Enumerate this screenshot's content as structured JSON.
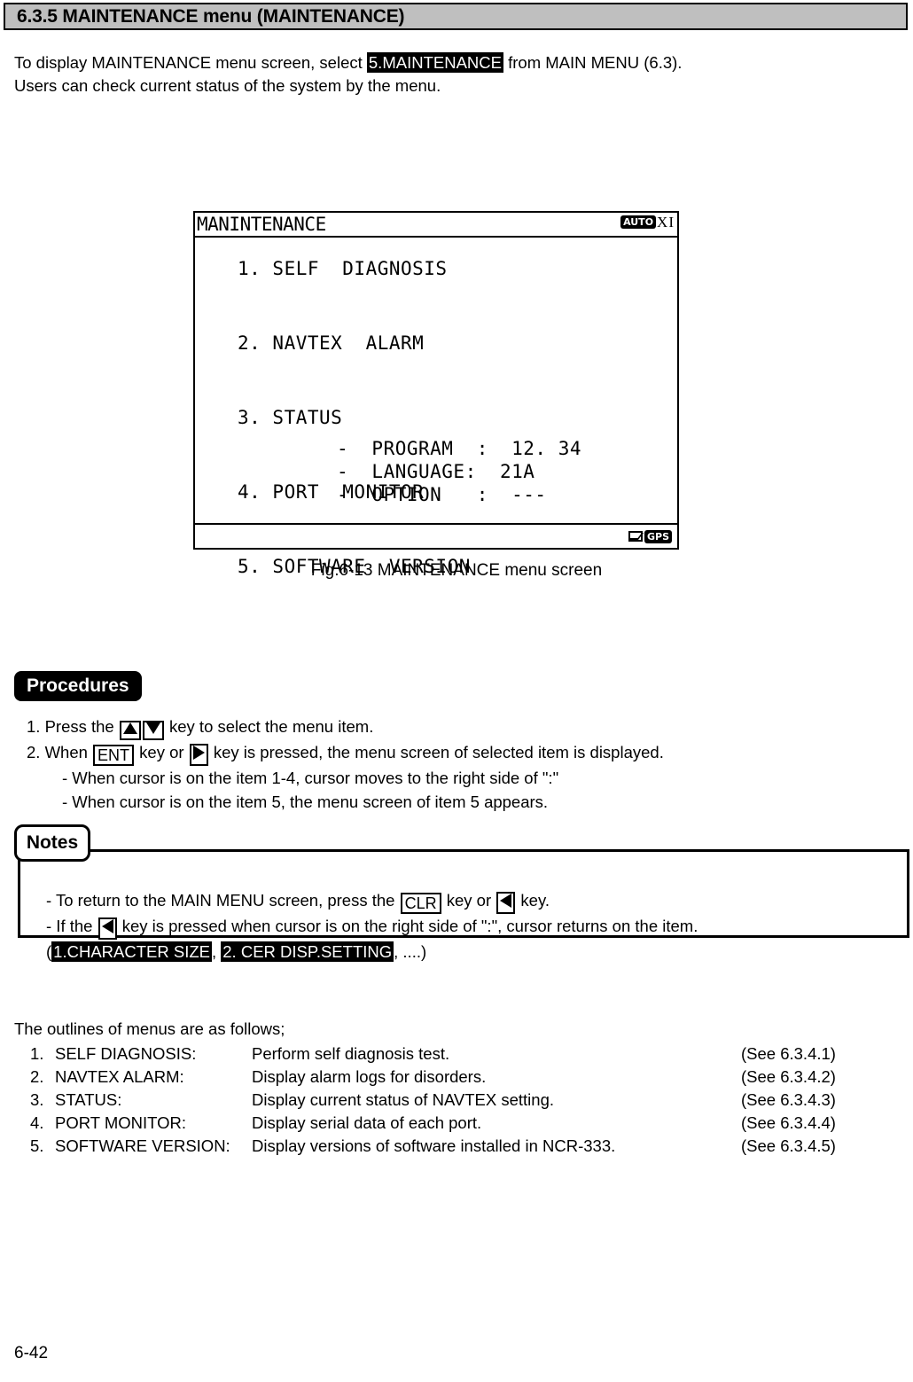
{
  "header": {
    "title": "6.3.5 MAINTENANCE menu (MAINTENANCE)"
  },
  "intro": {
    "line1_pre": "To display MAINTENANCE menu screen, select ",
    "line1_highlight": "5.MAINTENANCE",
    "line1_post": " from MAIN MENU (6.3).",
    "line2": "Users can check current status of the system by the menu."
  },
  "lcd": {
    "title": "MANINTENANCE",
    "status_badge": "AUTO",
    "status_char1": "X",
    "status_char2": "I",
    "menu_items": "1. SELF  DIAGNOSIS\n\n2. NAVTEX  ALARM\n\n3. STATUS\n\n4. PORT  MONITOR\n\n5. SOFTWARE  VERSION",
    "version_block": "-  PROGRAM  :  12. 34\n-  LANGUAGE:  21A\n-  OPTION   :  ---",
    "footer_gps_badge": "GPS",
    "footer_mail_icon": "mail-icon"
  },
  "figure": {
    "caption": "Fig.6-13 MAINTENANCE menu screen"
  },
  "procedures": {
    "badge": "Procedures",
    "step1_pre": "1. Press the ",
    "step1_post": " key to select the menu item.",
    "step2_pre": "2. When ",
    "step2_key": "ENT",
    "step2_mid": " key or ",
    "step2_post": " key is pressed, the menu screen of selected item is displayed.",
    "step2_sub1": "- When cursor is on the item 1-4, cursor moves to the right side of \":\"",
    "step2_sub2": "- When cursor is on the item 5, the menu screen of item 5 appears."
  },
  "notes": {
    "tab_label": "Notes",
    "note1_pre": "- To return to the MAIN MENU screen, press the ",
    "note1_key": "CLR",
    "note1_mid": " key or ",
    "note1_post": " key.",
    "note2_pre": "- If the ",
    "note2_post": " key is pressed when cursor is on the right side of \":\", cursor returns on the item.",
    "note2_line2_open": "(",
    "note2_hl1": "1.CHARACTER SIZE",
    "note2_sep": ", ",
    "note2_hl2": "2. CER DISP.SETTING",
    "note2_close": ", ....)"
  },
  "outlines": {
    "intro": "The outlines of menus are as follows;",
    "rows": [
      {
        "num": "1.",
        "name": "SELF DIAGNOSIS:",
        "desc": "Perform self diagnosis test.",
        "ref": "(See 6.3.4.1)"
      },
      {
        "num": "2.",
        "name": "NAVTEX ALARM:",
        "desc": "Display alarm logs for disorders.",
        "ref": "(See 6.3.4.2)"
      },
      {
        "num": "3.",
        "name": "STATUS:",
        "desc": "Display current status of NAVTEX setting.",
        "ref": "(See 6.3.4.3)"
      },
      {
        "num": "4.",
        "name": "PORT MONITOR:",
        "desc": "Display serial data of each port.",
        "ref": "(See 6.3.4.4)"
      },
      {
        "num": "5.",
        "name": "SOFTWARE VERSION:",
        "desc": "Display versions of software installed in NCR-333.",
        "ref": "(See 6.3.4.5)"
      }
    ]
  },
  "footer": {
    "page_number": "6-42"
  }
}
